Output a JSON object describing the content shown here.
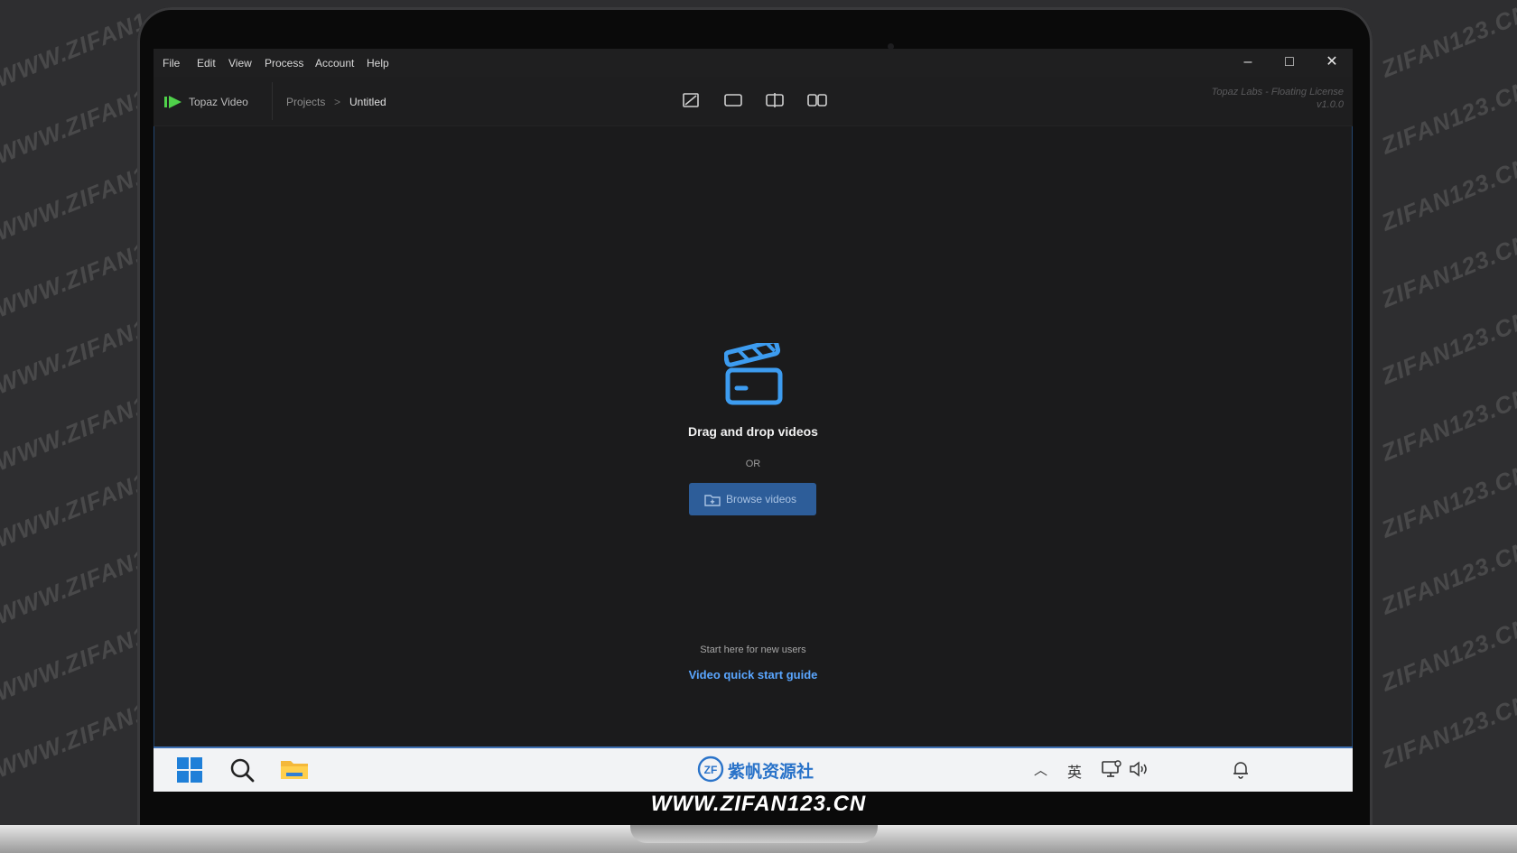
{
  "watermark": {
    "text_left": "WWW.ZIFAN1",
    "text_right": "ZIFAN123.CN",
    "caption": "WWW.ZIFAN123.CN"
  },
  "menubar": {
    "items": [
      "File",
      "Edit",
      "View",
      "Process",
      "Account",
      "Help"
    ],
    "controls": {
      "minimize": "–",
      "maximize": "□",
      "close": "✕"
    }
  },
  "toolbar": {
    "app_name": "Topaz Video",
    "breadcrumb": {
      "root": "Projects",
      "separator": ">",
      "current": "Untitled"
    },
    "view_modes": [
      "single-view-icon",
      "fullscreen-view-icon",
      "split-view-icon",
      "side-by-side-view-icon"
    ],
    "license_line1": "Topaz Labs - Floating License",
    "license_line2": "v1.0.0"
  },
  "main": {
    "drop_title": "Drag and drop videos",
    "or_text": "OR",
    "browse_label": "Browse videos",
    "start_here": "Start here for new users",
    "guide_link": "Video quick start guide"
  },
  "taskbar": {
    "logo_text": "紫帆资源社",
    "input_method": "英"
  },
  "colors": {
    "accent": "#2d5d99",
    "link": "#5aa6ff",
    "clapper": "#3d9cf0",
    "brand_green": "#4fd14a"
  }
}
